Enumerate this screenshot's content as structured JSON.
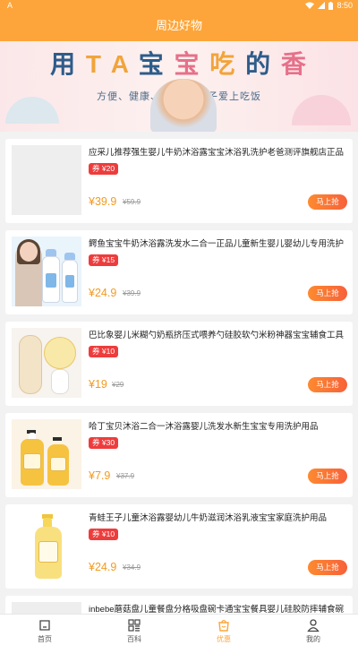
{
  "status_bar": {
    "left_icon": "A",
    "time": "8:50"
  },
  "header": {
    "title": "周边好物"
  },
  "banner": {
    "slogan_parts": [
      {
        "text": "用",
        "color": "#2e5c8a"
      },
      {
        "text": "T",
        "color": "#f2a43a"
      },
      {
        "text": "A",
        "color": "#f2a43a"
      },
      {
        "text": "宝",
        "color": "#2e5c8a"
      },
      {
        "text": "宝",
        "color": "#e6708a"
      },
      {
        "text": "吃",
        "color": "#f2a43a"
      },
      {
        "text": "的",
        "color": "#2e5c8a"
      },
      {
        "text": "香",
        "color": "#e6708a"
      }
    ],
    "subtitle": "方便、健康、卫生                    让孩子爱上吃饭"
  },
  "products": [
    {
      "title": "应采儿推荐强生婴儿牛奶沐浴露宝宝沐浴乳洗护老爸测评旗舰店正品",
      "coupon": "券 ¥20",
      "price": "¥39.9",
      "original_price": "¥59.9",
      "buy_label": "马上抢"
    },
    {
      "title": "鳄鱼宝宝牛奶沐浴露洗发水二合一正品儿童新生婴儿婴幼儿专用洗护",
      "coupon": "券 ¥15",
      "price": "¥24.9",
      "original_price": "¥39.9",
      "buy_label": "马上抢"
    },
    {
      "title": "巴比象婴儿米糊勺奶瓶挤压式喂养勺硅胶软勺米粉神器宝宝辅食工具",
      "coupon": "券 ¥10",
      "price": "¥19",
      "original_price": "¥29",
      "buy_label": "马上抢"
    },
    {
      "title": "哈丁宝贝沐浴二合一沐浴露婴儿洗发水新生宝宝专用洗护用品",
      "coupon": "券 ¥30",
      "price": "¥7.9",
      "original_price": "¥37.9",
      "buy_label": "马上抢"
    },
    {
      "title": "青蛙王子儿童沐浴露婴幼儿牛奶滋润沐浴乳液宝宝家庭洗护用品",
      "coupon": "券 ¥10",
      "price": "¥24.9",
      "original_price": "¥34.9",
      "buy_label": "马上抢"
    },
    {
      "title": "inbebe蘑菇盘儿童餐盘分格吸盘碗卡通宝宝餐具婴儿硅胶防摔辅食碗"
    }
  ],
  "tabs": [
    {
      "label": "首页",
      "icon": "home-icon",
      "active": false
    },
    {
      "label": "百科",
      "icon": "grid-icon",
      "active": false
    },
    {
      "label": "优惠",
      "icon": "shopping-bag-icon",
      "active": true
    },
    {
      "label": "我的",
      "icon": "person-icon",
      "active": false
    }
  ],
  "colors": {
    "accent": "#fda53a",
    "coupon": "#ee3c3c",
    "price": "#f39a1f",
    "buy_button": "#f7613a"
  }
}
